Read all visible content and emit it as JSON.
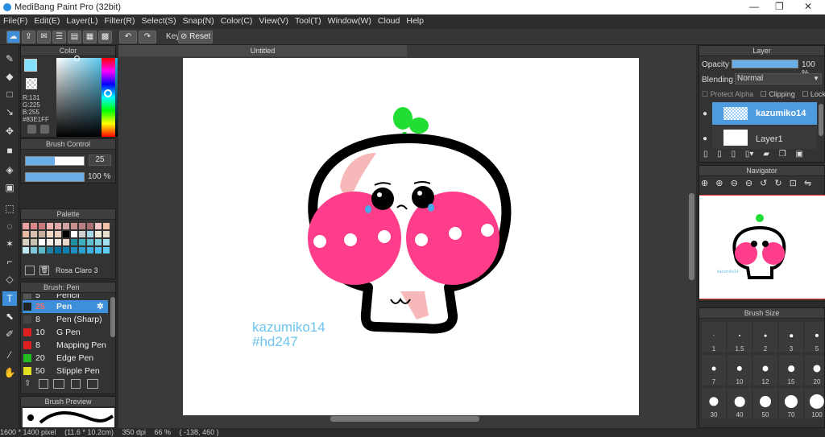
{
  "window": {
    "title": "MediBang Paint Pro (32bit)"
  },
  "menu": [
    "File(F)",
    "Edit(E)",
    "Layer(L)",
    "Filter(R)",
    "Select(S)",
    "Snap(N)",
    "Color(C)",
    "View(V)",
    "Tool(T)",
    "Window(W)",
    "Cloud",
    "Help"
  ],
  "toolbar": {
    "key_label": "Key",
    "reset_label": "Reset"
  },
  "color_panel": {
    "title": "Color",
    "r": "R:131",
    "g": "G:225",
    "b": "B:255",
    "hex": "#83E1FF",
    "fg_color": "#83e1ff"
  },
  "brush_control": {
    "title": "Brush Control",
    "size": "25",
    "opacity": "100 %",
    "size_fraction": 0.5,
    "opacity_fraction": 1.0
  },
  "palette": {
    "title": "Palette",
    "selected_name": "Rosa Claro 3"
  },
  "brush_panel": {
    "title": "Brush: Pen",
    "items": [
      {
        "size": "5",
        "name": "Pencil",
        "color": "#555555"
      },
      {
        "size": "25",
        "name": "Pen",
        "color": "#222222"
      },
      {
        "size": "8",
        "name": "Pen (Sharp)",
        "color": "#444444"
      },
      {
        "size": "10",
        "name": "G Pen",
        "color": "#e02020"
      },
      {
        "size": "8",
        "name": "Mapping Pen",
        "color": "#e02020"
      },
      {
        "size": "20",
        "name": "Edge Pen",
        "color": "#22bb22"
      },
      {
        "size": "50",
        "name": "Stipple Pen",
        "color": "#e0e020"
      }
    ]
  },
  "brush_preview": {
    "title": "Brush Preview"
  },
  "document": {
    "tab": "Untitled",
    "watermark_line1": "kazumiko14",
    "watermark_line2": "#hd247"
  },
  "layer_panel": {
    "title": "Layer",
    "opacity_label": "Opacity",
    "opacity_value": "100 %",
    "blending_label": "Blending",
    "blending_value": "Normal",
    "protect_alpha": "Protect Alpha",
    "clipping": "Clipping",
    "lock": "Lock",
    "layers": [
      {
        "name": "kazumiko14"
      },
      {
        "name": "Layer1"
      }
    ]
  },
  "navigator": {
    "title": "Navigator",
    "thumb_text": "kazumiko14"
  },
  "brush_size_panel": {
    "title": "Brush Size",
    "sizes": [
      "1",
      "1.5",
      "2",
      "3",
      "5",
      "7",
      "10",
      "12",
      "15",
      "20",
      "30",
      "40",
      "50",
      "70",
      "100"
    ]
  },
  "status": {
    "pixels": "1600 * 1400 pixel",
    "cm": "(11.6 * 10.2cm)",
    "dpi": "350 dpi",
    "zoom": "66 %",
    "coords": "( -138, 460 )"
  }
}
